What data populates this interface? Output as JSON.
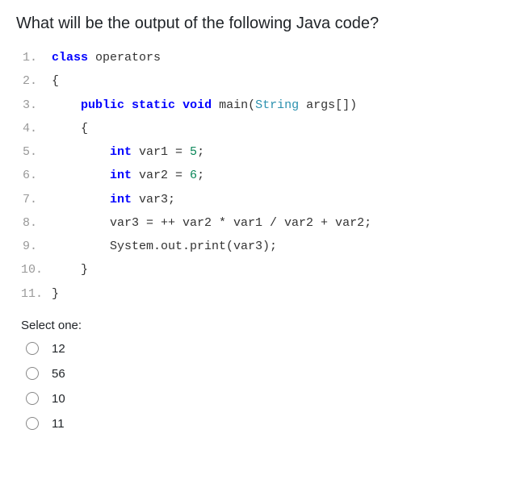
{
  "question": {
    "title": "What will be the output of the following Java code?",
    "select_label": "Select one:",
    "options": [
      "12",
      "56",
      "10",
      "11"
    ]
  },
  "code": {
    "lines": [
      {
        "num": "1.",
        "indent": 0,
        "tokens": [
          {
            "t": "class",
            "c": "kw"
          },
          {
            "t": " operators",
            "c": ""
          }
        ]
      },
      {
        "num": "2.",
        "indent": 0,
        "tokens": [
          {
            "t": "{",
            "c": ""
          }
        ]
      },
      {
        "num": "3.",
        "indent": 1,
        "tokens": [
          {
            "t": "public",
            "c": "kw"
          },
          {
            "t": " ",
            "c": ""
          },
          {
            "t": "static",
            "c": "kw"
          },
          {
            "t": " ",
            "c": ""
          },
          {
            "t": "void",
            "c": "kw"
          },
          {
            "t": " main(",
            "c": ""
          },
          {
            "t": "String",
            "c": "str-type"
          },
          {
            "t": " args[])",
            "c": ""
          }
        ]
      },
      {
        "num": "4.",
        "indent": 1,
        "tokens": [
          {
            "t": "{",
            "c": ""
          }
        ]
      },
      {
        "num": "5.",
        "indent": 2,
        "tokens": [
          {
            "t": "int",
            "c": "kw"
          },
          {
            "t": " var1 = ",
            "c": ""
          },
          {
            "t": "5",
            "c": "num"
          },
          {
            "t": ";",
            "c": ""
          }
        ]
      },
      {
        "num": "6.",
        "indent": 2,
        "tokens": [
          {
            "t": "int",
            "c": "kw"
          },
          {
            "t": " var2 = ",
            "c": ""
          },
          {
            "t": "6",
            "c": "num"
          },
          {
            "t": ";",
            "c": ""
          }
        ]
      },
      {
        "num": "7.",
        "indent": 2,
        "tokens": [
          {
            "t": "int",
            "c": "kw"
          },
          {
            "t": " var3;",
            "c": ""
          }
        ]
      },
      {
        "num": "8.",
        "indent": 2,
        "tokens": [
          {
            "t": "var3 = ++ var2 * var1 / var2 + var2;",
            "c": ""
          }
        ]
      },
      {
        "num": "9.",
        "indent": 2,
        "tokens": [
          {
            "t": "System.out.print(var3);",
            "c": ""
          }
        ]
      },
      {
        "num": "10.",
        "indent": 1,
        "tokens": [
          {
            "t": "}",
            "c": ""
          }
        ]
      },
      {
        "num": "11.",
        "indent": 0,
        "tokens": [
          {
            "t": "}",
            "c": ""
          }
        ]
      }
    ]
  }
}
